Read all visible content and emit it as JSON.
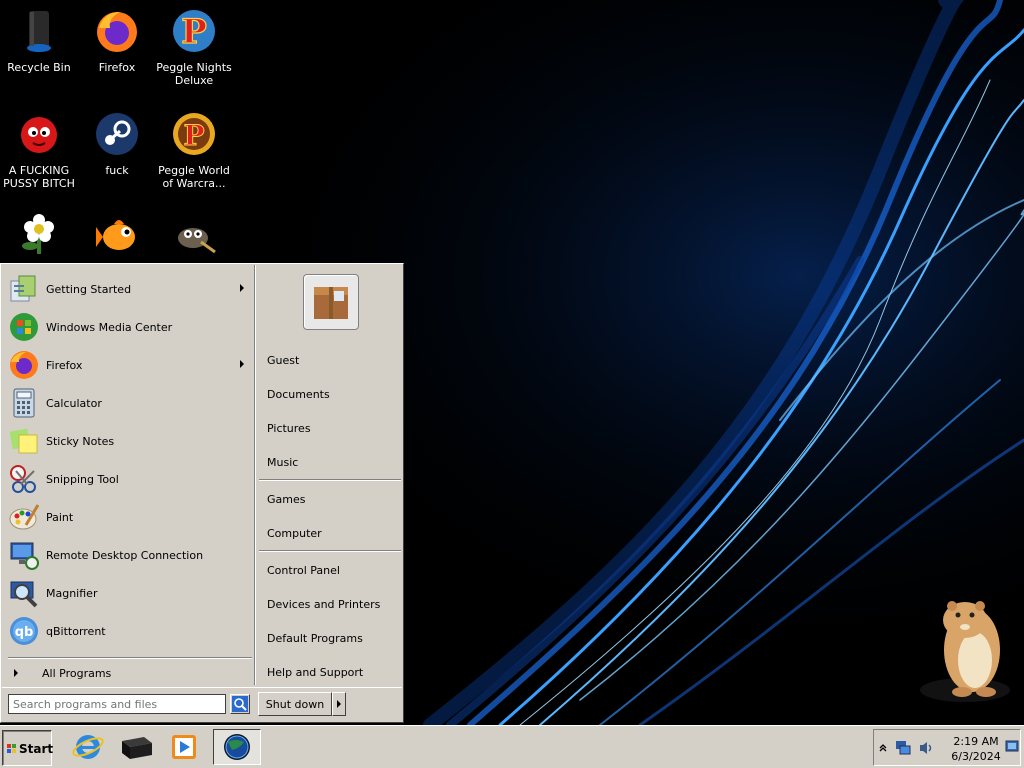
{
  "desktop": {
    "icons": [
      {
        "label": "Recycle Bin",
        "icon": "recycle-bin-icon"
      },
      {
        "label": "Firefox",
        "icon": "firefox-icon"
      },
      {
        "label": "Peggle Nights Deluxe",
        "icon": "peggle-nights-icon"
      },
      {
        "label": "A FUCKING PUSSY BITCH",
        "icon": "red-fuzzy-creature-icon"
      },
      {
        "label": "fuck",
        "icon": "steam-icon"
      },
      {
        "label": "Peggle World of Warcra...",
        "icon": "peggle-world-icon"
      },
      {
        "label": "",
        "icon": "flower-plant-icon"
      },
      {
        "label": "",
        "icon": "goldfish-icon"
      },
      {
        "label": "",
        "icon": "gimp-icon"
      }
    ]
  },
  "start_menu": {
    "programs": [
      {
        "label": "Getting Started",
        "icon": "getting-started-icon",
        "submenu": true
      },
      {
        "label": "Windows Media Center",
        "icon": "media-center-icon",
        "submenu": false
      },
      {
        "label": "Firefox",
        "icon": "firefox-icon",
        "submenu": true
      },
      {
        "label": "Calculator",
        "icon": "calculator-icon",
        "submenu": false
      },
      {
        "label": "Sticky Notes",
        "icon": "sticky-notes-icon",
        "submenu": false
      },
      {
        "label": "Snipping Tool",
        "icon": "snipping-tool-icon",
        "submenu": false
      },
      {
        "label": "Paint",
        "icon": "paint-icon",
        "submenu": false
      },
      {
        "label": "Remote Desktop Connection",
        "icon": "remote-desktop-icon",
        "submenu": false
      },
      {
        "label": "Magnifier",
        "icon": "magnifier-icon",
        "submenu": false
      },
      {
        "label": "qBittorrent",
        "icon": "qbittorrent-icon",
        "submenu": false
      }
    ],
    "all_programs": "All Programs",
    "search_placeholder": "Search programs and files",
    "right_items": {
      "guest": "Guest",
      "documents": "Documents",
      "pictures": "Pictures",
      "music": "Music",
      "games": "Games",
      "computer": "Computer",
      "control_panel": "Control Panel",
      "devices": "Devices and Printers",
      "default_programs": "Default Programs",
      "help": "Help and Support"
    },
    "shutdown": "Shut down"
  },
  "taskbar": {
    "start": "Start",
    "pinned": [
      "internet-explorer-icon",
      "black-box-icon",
      "media-player-icon",
      "globe-app-icon"
    ],
    "clock_time": "2:19 AM",
    "clock_date": "6/3/2024"
  },
  "colors": {
    "chrome": "#d4d0c8",
    "wallpaper_accent": "#1e90ff"
  }
}
